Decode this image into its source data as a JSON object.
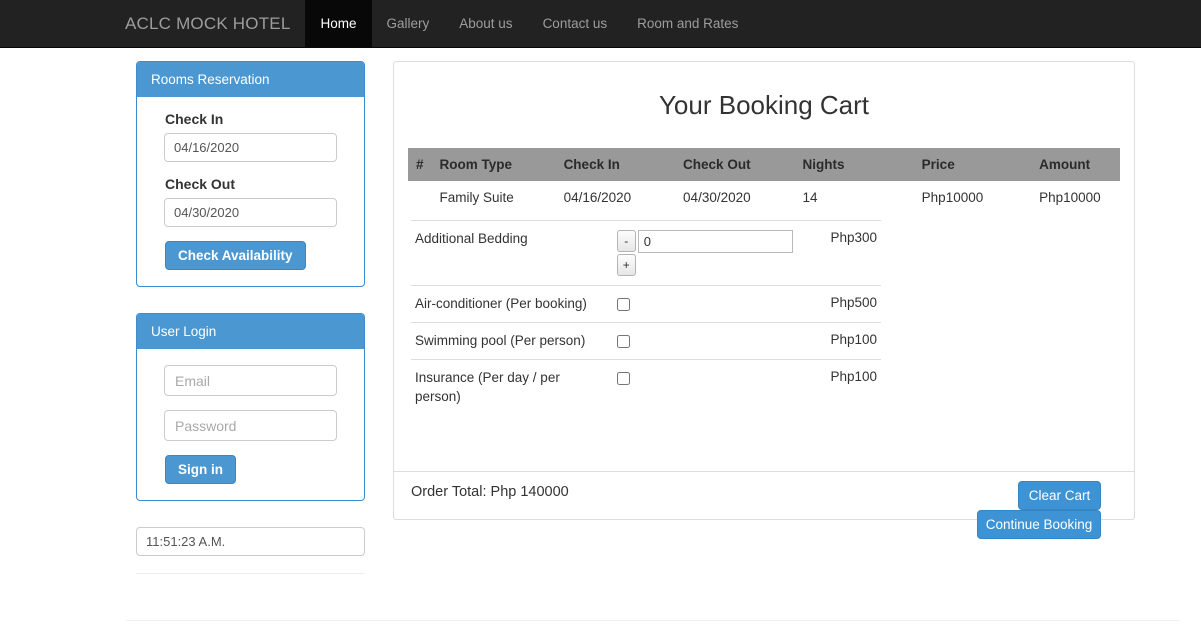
{
  "navbar": {
    "brand": "ACLC MOCK HOTEL",
    "items": [
      {
        "label": "Home",
        "active": true
      },
      {
        "label": "Gallery",
        "active": false
      },
      {
        "label": "About us",
        "active": false
      },
      {
        "label": "Contact us",
        "active": false
      },
      {
        "label": "Room and Rates",
        "active": false
      }
    ]
  },
  "sidebar": {
    "reservation": {
      "title": "Rooms Reservation",
      "checkin_label": "Check In",
      "checkin_value": "04/16/2020",
      "checkout_label": "Check Out",
      "checkout_value": "04/30/2020",
      "submit_label": "Check Availability"
    },
    "login": {
      "title": "User Login",
      "email_placeholder": "Email",
      "email_value": "",
      "password_placeholder": "Password",
      "password_value": "",
      "submit_label": "Sign in"
    },
    "clock": {
      "value": "11:51:23 A.M."
    }
  },
  "main": {
    "title": "Your Booking Cart",
    "cart_table": {
      "headers": [
        "#",
        "Room Type",
        "Check In",
        "Check Out",
        "Nights",
        "Price",
        "Amount"
      ],
      "rows": [
        {
          "num": "",
          "room_type": "Family Suite",
          "check_in": "04/16/2020",
          "check_out": "04/30/2020",
          "nights": "14",
          "price": "Php10000",
          "amount": "Php10000"
        }
      ]
    },
    "addons": [
      {
        "name": "Additional Bedding",
        "control": "stepper",
        "minus_label": "-",
        "plus_label": "+",
        "quantity": "0",
        "price": "Php300"
      },
      {
        "name": "Air-conditioner (Per booking)",
        "control": "checkbox",
        "checked": false,
        "price": "Php500"
      },
      {
        "name": "Swimming pool (Per person)",
        "control": "checkbox",
        "checked": false,
        "price": "Php100"
      },
      {
        "name": "Insurance (Per day / per person)",
        "control": "checkbox",
        "checked": false,
        "price": "Php100"
      }
    ],
    "order_total": "Order Total: Php 140000",
    "clear_cart_label": "Clear Cart",
    "continue_booking_label": "Continue Booking"
  },
  "colors": {
    "navbar_bg": "#222222",
    "navbar_active_bg": "#080808",
    "brand_text": "#9d9d9d",
    "panel_accent": "#4a97d2",
    "table_header_bg": "#999999",
    "button_blue": "#3e93d4"
  }
}
